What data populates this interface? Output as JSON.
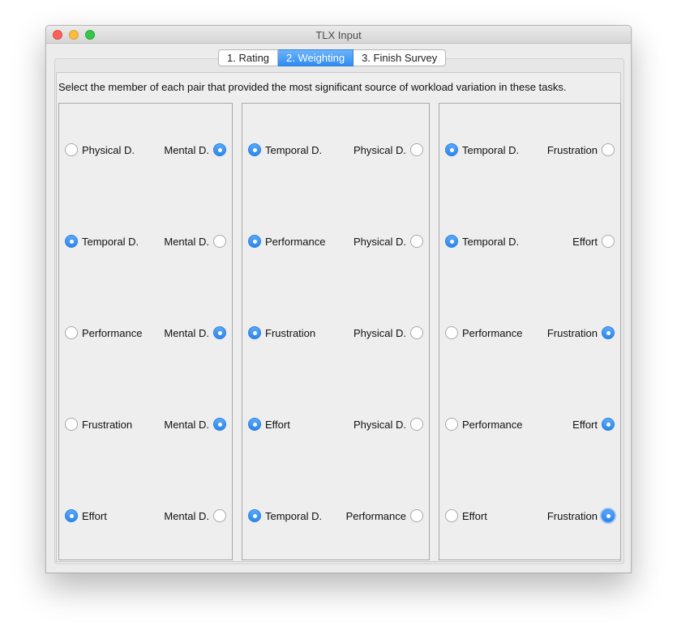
{
  "window": {
    "title": "TLX Input"
  },
  "tabs": [
    {
      "label": "1. Rating",
      "active": false
    },
    {
      "label": "2. Weighting",
      "active": true
    },
    {
      "label": "3. Finish Survey",
      "active": false
    }
  ],
  "instruction": "Select the member of each pair that provided the most significant source of workload variation in these tasks.",
  "columns": [
    {
      "pairs": [
        {
          "left": "Physical D.",
          "right": "Mental D.",
          "selected": "right"
        },
        {
          "left": "Temporal D.",
          "right": "Mental D.",
          "selected": "left"
        },
        {
          "left": "Performance",
          "right": "Mental D.",
          "selected": "right"
        },
        {
          "left": "Frustration",
          "right": "Mental D.",
          "selected": "right"
        },
        {
          "left": "Effort",
          "right": "Mental D.",
          "selected": "left"
        }
      ]
    },
    {
      "pairs": [
        {
          "left": "Temporal D.",
          "right": "Physical D.",
          "selected": "left"
        },
        {
          "left": "Performance",
          "right": "Physical D.",
          "selected": "left"
        },
        {
          "left": "Frustration",
          "right": "Physical D.",
          "selected": "left"
        },
        {
          "left": "Effort",
          "right": "Physical D.",
          "selected": "left"
        },
        {
          "left": "Temporal D.",
          "right": "Performance",
          "selected": "left"
        }
      ]
    },
    {
      "pairs": [
        {
          "left": "Temporal D.",
          "right": "Frustration",
          "selected": "left"
        },
        {
          "left": "Temporal D.",
          "right": "Effort",
          "selected": "left"
        },
        {
          "left": "Performance",
          "right": "Frustration",
          "selected": "right"
        },
        {
          "left": "Performance",
          "right": "Effort",
          "selected": "right"
        },
        {
          "left": "Effort",
          "right": "Frustration",
          "selected": "right",
          "focused": true
        }
      ]
    }
  ],
  "colors": {
    "accent": "#2f8cf2",
    "radio_border": "#a8a8a8",
    "panel_bg": "#eeeeee"
  }
}
